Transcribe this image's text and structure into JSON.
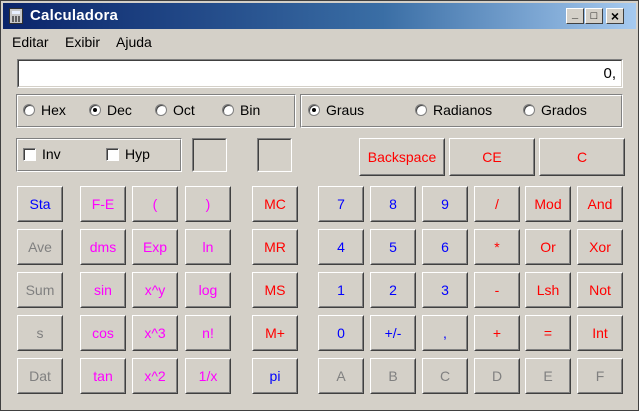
{
  "window": {
    "title": "Calculadora",
    "minimize": "_",
    "maximize": "□",
    "close": "×"
  },
  "menu": [
    "Editar",
    "Exibir",
    "Ajuda"
  ],
  "display": {
    "value": "0,"
  },
  "base": {
    "options": [
      "Hex",
      "Dec",
      "Oct",
      "Bin"
    ],
    "selected": "Dec"
  },
  "angle": {
    "options": [
      "Graus",
      "Radianos",
      "Grados"
    ],
    "selected": "Graus"
  },
  "checks": {
    "inv": "Inv",
    "hyp": "Hyp"
  },
  "top_buttons": {
    "backspace": "Backspace",
    "ce": "CE",
    "c": "C"
  },
  "stat": [
    "Sta",
    "Ave",
    "Sum",
    "s",
    "Dat"
  ],
  "sci": [
    [
      "F-E",
      "(",
      ")"
    ],
    [
      "dms",
      "Exp",
      "ln"
    ],
    [
      "sin",
      "x^y",
      "log"
    ],
    [
      "cos",
      "x^3",
      "n!"
    ],
    [
      "tan",
      "x^2",
      "1/x"
    ]
  ],
  "mem": [
    "MC",
    "MR",
    "MS",
    "M+",
    "pi"
  ],
  "pad": [
    [
      "7",
      "8",
      "9",
      "/",
      "Mod",
      "And"
    ],
    [
      "4",
      "5",
      "6",
      "*",
      "Or",
      "Xor"
    ],
    [
      "1",
      "2",
      "3",
      "-",
      "Lsh",
      "Not"
    ],
    [
      "0",
      "+/-",
      ",",
      "+",
      "=",
      "Int"
    ],
    [
      "A",
      "B",
      "C",
      "D",
      "E",
      "F"
    ]
  ],
  "colors": {
    "title_start": "#0a246a",
    "title_end": "#a6caf0",
    "face": "#d4d0c8",
    "blue": "#0000ff",
    "red": "#ff0000",
    "magenta": "#ff00ff",
    "disabled": "#808080"
  }
}
